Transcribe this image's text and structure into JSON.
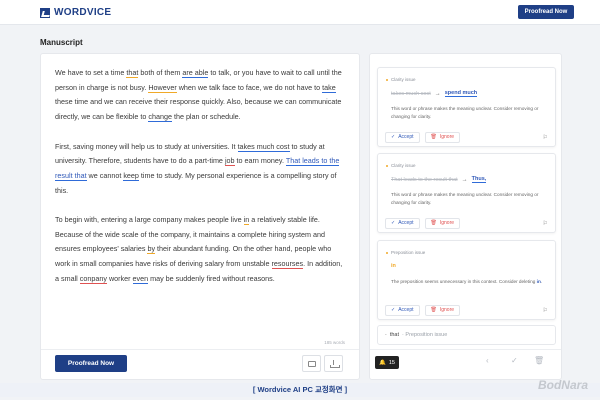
{
  "header": {
    "logo": "WORDVICE",
    "proofread_button": "Proofread Now"
  },
  "page_title": "Manuscript",
  "editor": {
    "p1": [
      {
        "t": "We have to set a time ",
        "s": ""
      },
      {
        "t": "that",
        "s": "u-yellow"
      },
      {
        "t": " both of them ",
        "s": ""
      },
      {
        "t": "are able",
        "s": "u-blue"
      },
      {
        "t": " to talk, or you have to wait to call until the person in charge is not busy. ",
        "s": ""
      },
      {
        "t": "However",
        "s": "u-yellow"
      },
      {
        "t": " when we talk face to face, we do not have to ",
        "s": ""
      },
      {
        "t": "take",
        "s": "u-blue"
      },
      {
        "t": " these time and we can receive their response quickly. Also, because we can communicate directly, we can be flexible to ",
        "s": ""
      },
      {
        "t": "change",
        "s": "u-blue"
      },
      {
        "t": " the plan or schedule.",
        "s": ""
      }
    ],
    "p2": [
      {
        "t": "First, saving money will help us to study at universities. It ",
        "s": ""
      },
      {
        "t": "takes much cost",
        "s": "u-blue"
      },
      {
        "t": " to study at university. Therefore, students have to do a part-time ",
        "s": ""
      },
      {
        "t": "job",
        "s": "u-red"
      },
      {
        "t": " to earn money. ",
        "s": ""
      },
      {
        "t": "That leads to the result that",
        "s": "u-blue-hl"
      },
      {
        "t": " we cannot ",
        "s": ""
      },
      {
        "t": "keep",
        "s": "u-blue"
      },
      {
        "t": " time to study. My personal experience is a compelling story of this.",
        "s": ""
      }
    ],
    "p3": [
      {
        "t": "To begin with, entering a large company makes people live ",
        "s": ""
      },
      {
        "t": "in",
        "s": "u-yellow"
      },
      {
        "t": " a relatively stable life. Because of the wide scale of the company, it maintains a complete hiring system and ensures employees' salaries ",
        "s": ""
      },
      {
        "t": "by",
        "s": "u-yellow"
      },
      {
        "t": " their abundant funding. On the other hand, people who work in small companies have risks of deriving salary from unstable ",
        "s": ""
      },
      {
        "t": "resourses",
        "s": "u-red"
      },
      {
        "t": ". In addition, a small ",
        "s": ""
      },
      {
        "t": "conpany",
        "s": "u-red"
      },
      {
        "t": " worker ",
        "s": ""
      },
      {
        "t": "even",
        "s": "u-blue"
      },
      {
        "t": " may be suddenly fired without reasons.",
        "s": ""
      }
    ],
    "word_count": "185 words",
    "proofread_button": "Proofread Now"
  },
  "issues": [
    {
      "type": "Clarity issue",
      "original": "takes much cost",
      "suggestion": "spend much",
      "description": "This word or phrase makes the meaning unclear. Consider removing or changing for clarity.",
      "accept": "Accept",
      "ignore": "Ignore"
    },
    {
      "type": "Clarity issue",
      "original": "That leads to the result that",
      "suggestion": "Thus,",
      "description": "This word or phrase makes the meaning unclear. Consider removing or changing for clarity.",
      "accept": "Accept",
      "ignore": "Ignore"
    },
    {
      "type": "Preposition issue",
      "original": "",
      "suggestion": "in",
      "description_pre": "The preposition seems unnecessary in this context. Consider deleting ",
      "description_word": "in",
      "description_post": ".",
      "accept": "Accept",
      "ignore": "Ignore"
    }
  ],
  "next_issue": {
    "word": "that",
    "type": "Preposition issue"
  },
  "issue_count": "15",
  "caption": "[ Wordvice AI PC 교정화면 ]",
  "watermark": "BodNara"
}
